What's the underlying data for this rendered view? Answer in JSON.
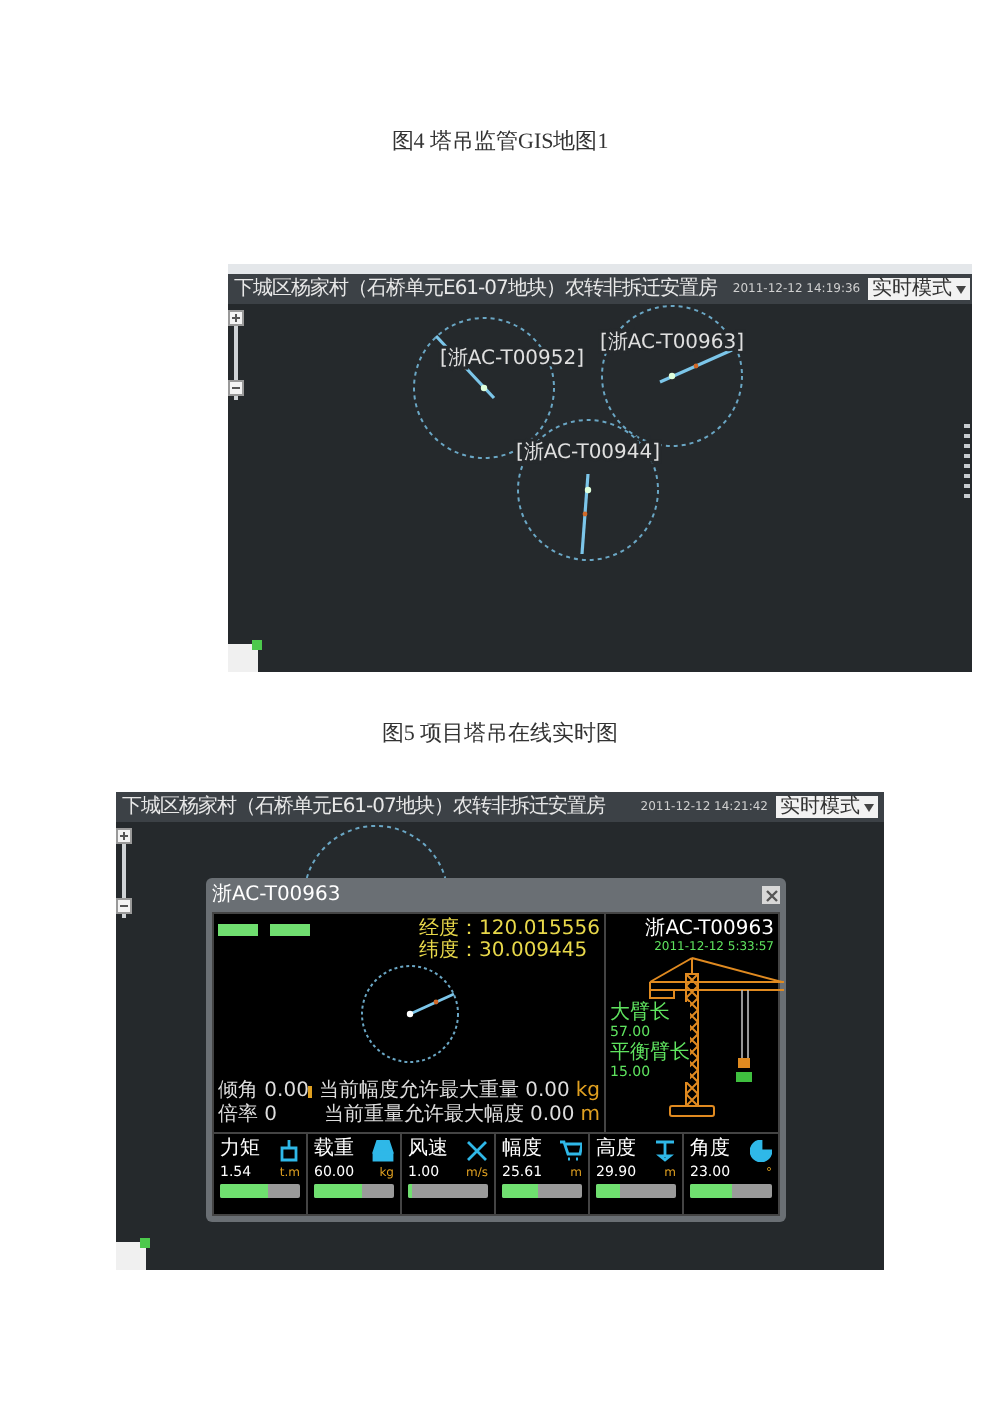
{
  "figures": [
    {
      "caption": "图4 塔吊监管GIS地图1",
      "screen": {
        "title": "下城区杨家村（石桥单元E61-07地块）农转非拆迁安置房",
        "datetime": "2011-12-12 14:19:36",
        "mode": "实时模式",
        "cranes": [
          {
            "label": "[浙AC-T00952]"
          },
          {
            "label": "[浙AC-T00963]"
          },
          {
            "label": "[浙AC-T00944]"
          }
        ]
      }
    },
    {
      "caption": "图5 项目塔吊在线实时图",
      "screen": {
        "title": "下城区杨家村（石桥单元E61-07地块）农转非拆迁安置房",
        "datetime": "2011-12-12 14:21:42",
        "mode": "实时模式",
        "dialog": {
          "title": "浙AC-T00963",
          "coords": [
            "经度：120.015556",
            "纬度：30.009445"
          ],
          "info_rows": [
            {
              "left": "倾角 0.00",
              "limit": "当前幅度允许最大重量 0.00",
              "unit": "kg"
            },
            {
              "left": "倍率 0",
              "limit": "当前重量允许最大幅度 0.00",
              "unit": "m"
            }
          ],
          "crane_id": "浙AC-T00963",
          "crane_time": "2011-12-12 5:33:57",
          "arm_specs": [
            {
              "label": "大臂长",
              "value": "57.00"
            },
            {
              "label": "平衡臂长",
              "value": "15.00"
            }
          ],
          "meters": [
            {
              "label": "力矩",
              "value": "1.54",
              "unit": "t.m",
              "level": 0.6
            },
            {
              "label": "载重",
              "value": "60.00",
              "unit": "kg",
              "level": 0.6
            },
            {
              "label": "风速",
              "value": "1.00",
              "unit": "m/s",
              "level": 0.05
            },
            {
              "label": "幅度",
              "value": "25.61",
              "unit": "m",
              "level": 0.45
            },
            {
              "label": "高度",
              "value": "29.90",
              "unit": "m",
              "level": 0.3
            },
            {
              "label": "角度",
              "value": "23.00",
              "unit": "°",
              "level": 0.5
            }
          ]
        }
      }
    }
  ]
}
